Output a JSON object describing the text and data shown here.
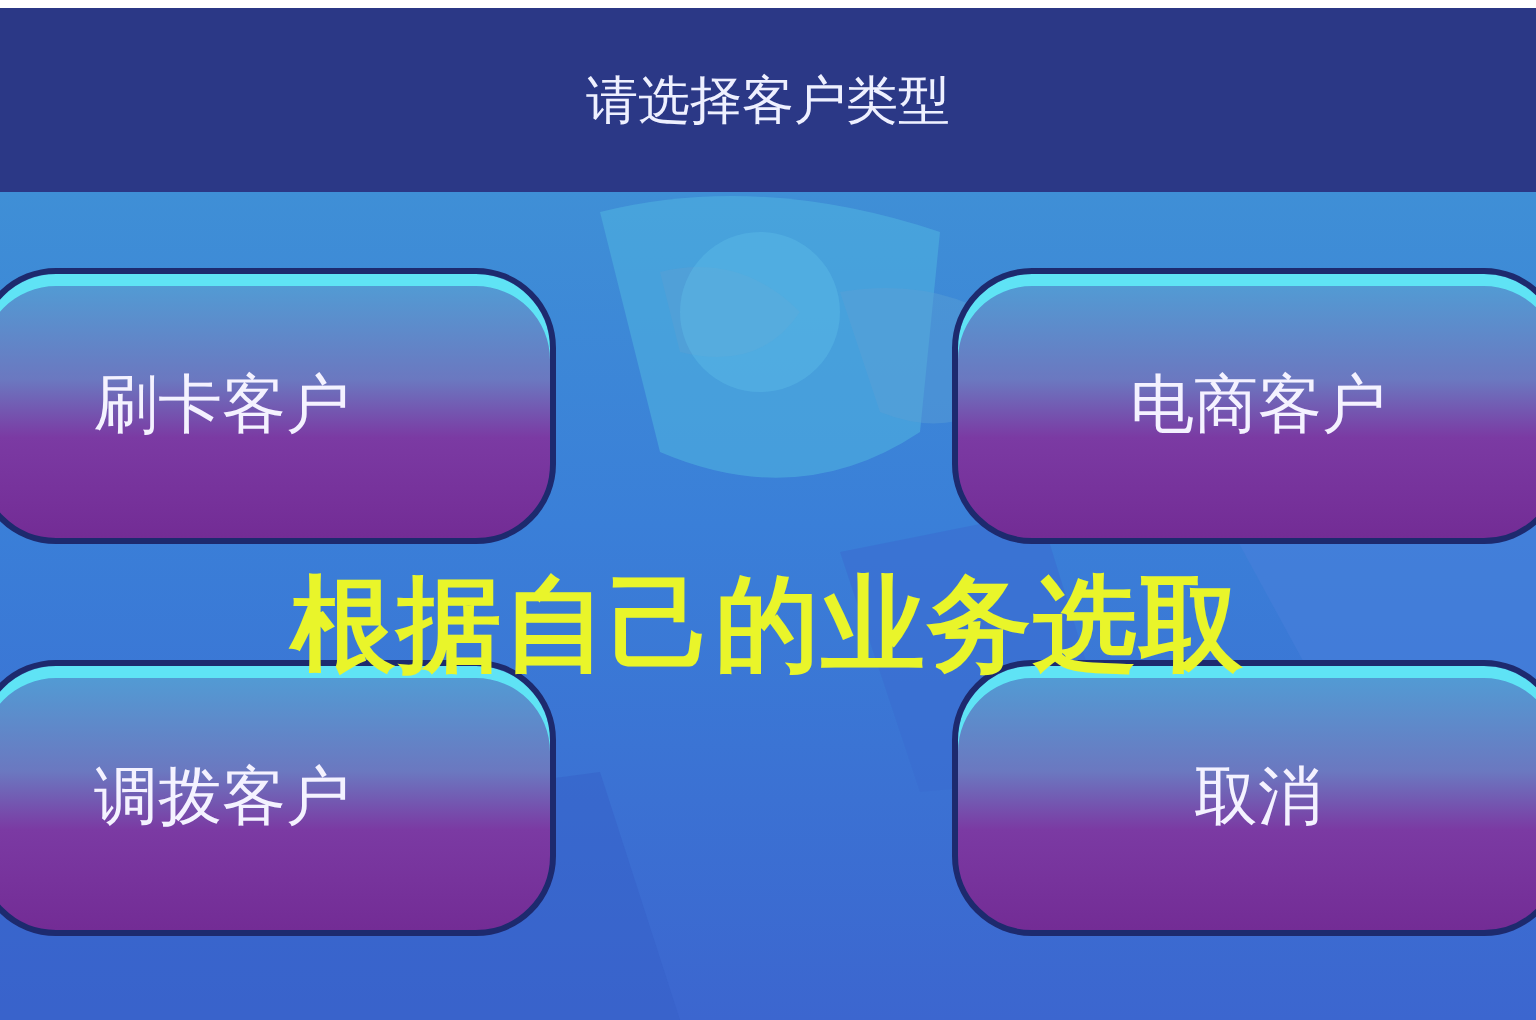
{
  "header": {
    "title": "请选择客户类型"
  },
  "buttons": [
    {
      "label": "刷卡客户"
    },
    {
      "label": "电商客户"
    },
    {
      "label": "调拨客户"
    },
    {
      "label": "取消"
    }
  ],
  "annotation": {
    "text": "根据自己的业务选取"
  }
}
